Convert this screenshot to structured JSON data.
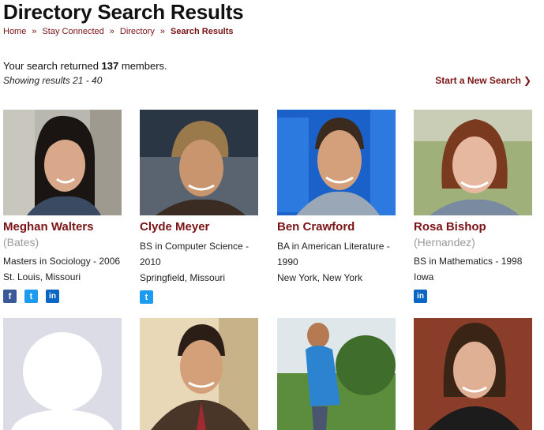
{
  "page": {
    "title": "Directory Search Results"
  },
  "breadcrumb": [
    "Home",
    "Stay Connected",
    "Directory",
    "Search Results"
  ],
  "results": {
    "prefix": "Your search returned ",
    "count": "137",
    "suffix": " members.",
    "showing": "Showing results 21 - 40",
    "new_search_label": "Start a New Search"
  },
  "members": [
    {
      "name": "Meghan Walters",
      "maiden": "(Bates)",
      "degree": "Masters in Sociology - 2006",
      "location": "St. Louis, Missouri",
      "social": [
        "facebook-icon",
        "twitter-icon",
        "linkedin-icon"
      ]
    },
    {
      "name": "Clyde Meyer",
      "maiden": "",
      "degree": "BS in Computer Science - 2010",
      "location": "Springfield, Missouri",
      "social": [
        "twitter-icon"
      ]
    },
    {
      "name": "Ben Crawford",
      "maiden": "",
      "degree": "BA in American Literature - 1990",
      "location": "New York, New York",
      "social": []
    },
    {
      "name": "Rosa Bishop",
      "maiden": "(Hernandez)",
      "degree": "BS in Mathematics - 1998",
      "location": "Iowa",
      "social": [
        "linkedin-icon"
      ]
    }
  ],
  "colors": {
    "accent": "#7a1315",
    "facebook": "#3b5998",
    "twitter": "#1d9bf0",
    "linkedin": "#0a66c2"
  }
}
